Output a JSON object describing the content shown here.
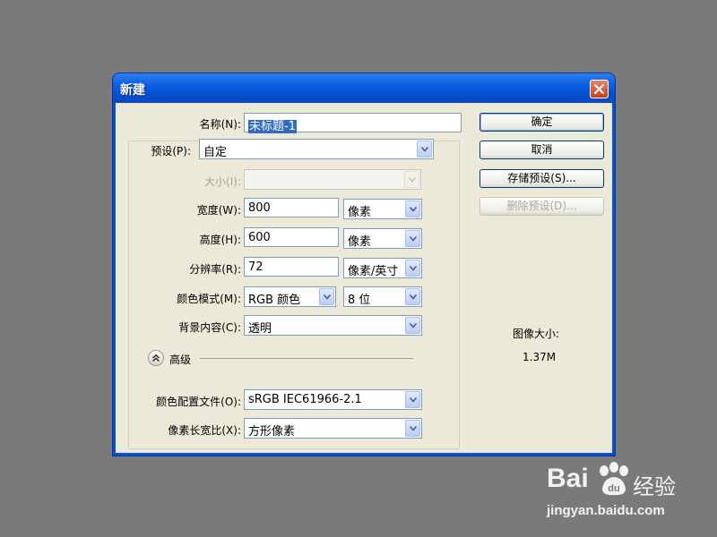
{
  "dialog": {
    "title": "新建",
    "name_label": "名称(N):",
    "name_value": "未标题-1",
    "preset_label": "预设(P):",
    "preset_value": "自定",
    "size_label": "大小(I):",
    "size_value": "",
    "width_label": "宽度(W):",
    "width_value": "800",
    "width_unit": "像素",
    "height_label": "高度(H):",
    "height_value": "600",
    "height_unit": "像素",
    "resolution_label": "分辨率(R):",
    "resolution_value": "72",
    "resolution_unit": "像素/英寸",
    "color_mode_label": "颜色模式(M):",
    "color_mode_value": "RGB 颜色",
    "bit_depth_value": "8 位",
    "background_label": "背景内容(C):",
    "background_value": "透明",
    "advanced_label": "高级",
    "color_profile_label": "颜色配置文件(O):",
    "color_profile_value": "sRGB IEC61966-2.1",
    "pixel_aspect_label": "像素长宽比(X):",
    "pixel_aspect_value": "方形像素",
    "image_size_label": "图像大小:",
    "image_size_value": "1.37M"
  },
  "buttons": {
    "ok": "确定",
    "cancel": "取消",
    "save_preset": "存储预设(S)...",
    "delete_preset": "删除预设(D)..."
  },
  "watermark": {
    "brand": "Bai",
    "brand_suffix": "经验",
    "url": "jingyan.baidu.com"
  },
  "icons": {
    "close": "close-icon",
    "dropdown": "chevron-down-icon",
    "collapse": "double-chevron-up-icon",
    "paw": "paw-icon"
  },
  "colors": {
    "titlebar": "#0c5fe0",
    "close": "#c8401e",
    "client_bg": "#ece9d8",
    "selection": "#316ac5"
  }
}
